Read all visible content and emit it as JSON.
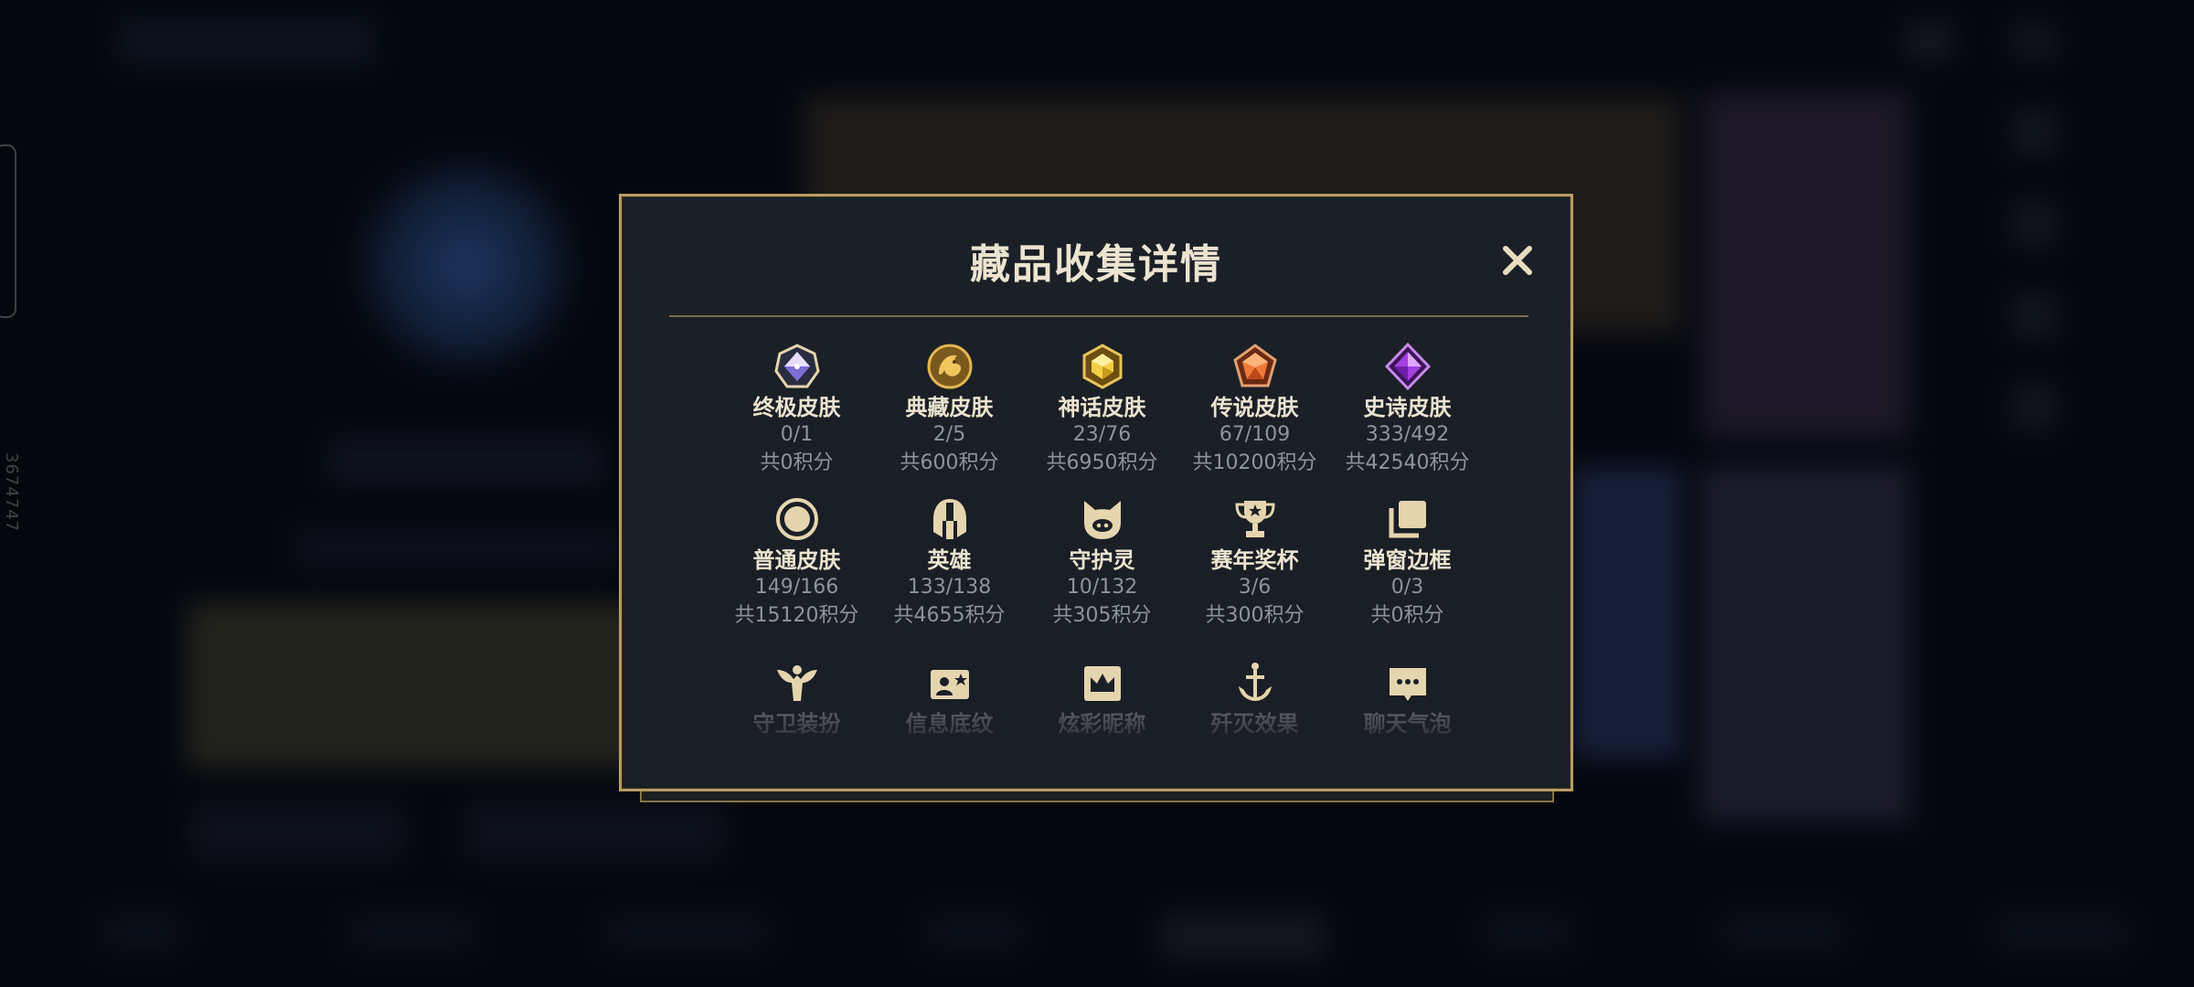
{
  "background": {
    "side_id": "3674747"
  },
  "modal": {
    "title": "藏品收集详情",
    "close_label": "✕",
    "items": [
      {
        "icon": "ultimate-skin-gem-icon",
        "label": "终极皮肤",
        "count": "0/1",
        "points": "共0积分"
      },
      {
        "icon": "prestige-skin-dragon-icon",
        "label": "典藏皮肤",
        "count": "2/5",
        "points": "共600积分"
      },
      {
        "icon": "mythic-skin-gem-icon",
        "label": "神话皮肤",
        "count": "23/76",
        "points": "共6950积分"
      },
      {
        "icon": "legendary-skin-gem-icon",
        "label": "传说皮肤",
        "count": "67/109",
        "points": "共10200积分"
      },
      {
        "icon": "epic-skin-gem-icon",
        "label": "史诗皮肤",
        "count": "333/492",
        "points": "共42540积分"
      },
      {
        "icon": "standard-skin-ring-icon",
        "label": "普通皮肤",
        "count": "149/166",
        "points": "共15120积分"
      },
      {
        "icon": "champion-helmet-icon",
        "label": "英雄",
        "count": "133/138",
        "points": "共4655积分"
      },
      {
        "icon": "companion-face-icon",
        "label": "守护灵",
        "count": "10/132",
        "points": "共305积分"
      },
      {
        "icon": "trophy-icon",
        "label": "赛年奖杯",
        "count": "3/6",
        "points": "共300积分"
      },
      {
        "icon": "popup-frame-icon",
        "label": "弹窗边框",
        "count": "0/3",
        "points": "共0积分"
      },
      {
        "icon": "ward-skin-icon",
        "label": "守卫装扮"
      },
      {
        "icon": "profile-banner-icon",
        "label": "信息底纹"
      },
      {
        "icon": "nickname-crown-icon",
        "label": "炫彩昵称"
      },
      {
        "icon": "finisher-effect-icon",
        "label": "歼灭效果"
      },
      {
        "icon": "chat-bubble-icon",
        "label": "聊天气泡"
      }
    ]
  },
  "colors": {
    "gold_border": "#b99c62",
    "icon_gold": "#e5d5ae",
    "title_text": "#ece4d0",
    "muted_text": "#8e939c"
  }
}
